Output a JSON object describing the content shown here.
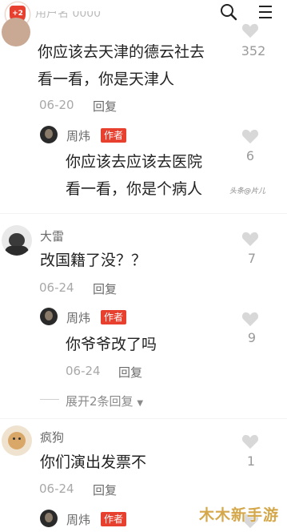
{
  "top": {
    "badge_text": "+2",
    "partial_text": "用户名 0000"
  },
  "comments": [
    {
      "text_lines": [
        "你应该去天津的德云社去",
        "看一看，你是天津人"
      ],
      "date": "06-20",
      "reply_label": "回复",
      "likes": "352",
      "reply": {
        "name": "周炜",
        "tag": "作者",
        "text_lines": [
          "你应该去应该去医院",
          "看一看，你是个病人"
        ],
        "likes": "6"
      }
    },
    {
      "name": "大雷",
      "text": "改国籍了没？？",
      "date": "06-24",
      "reply_label": "回复",
      "likes": "7",
      "reply": {
        "name": "周炜",
        "tag": "作者",
        "text": "你爷爷改了吗",
        "date": "06-24",
        "reply_label": "回复",
        "likes": "9"
      },
      "expand_label": "展开2条回复"
    },
    {
      "name": "疯狗",
      "text": "你们演出发票不",
      "date": "06-24",
      "reply_label": "回复",
      "likes": "1",
      "reply": {
        "name": "周炜",
        "tag": "作者"
      }
    }
  ],
  "watermarks": {
    "source": "头条@片儿",
    "corner": "木木新手游"
  },
  "colors": {
    "accent": "#e8402f",
    "heart": "#d8d8d8",
    "watermark": "#d4a84a"
  }
}
